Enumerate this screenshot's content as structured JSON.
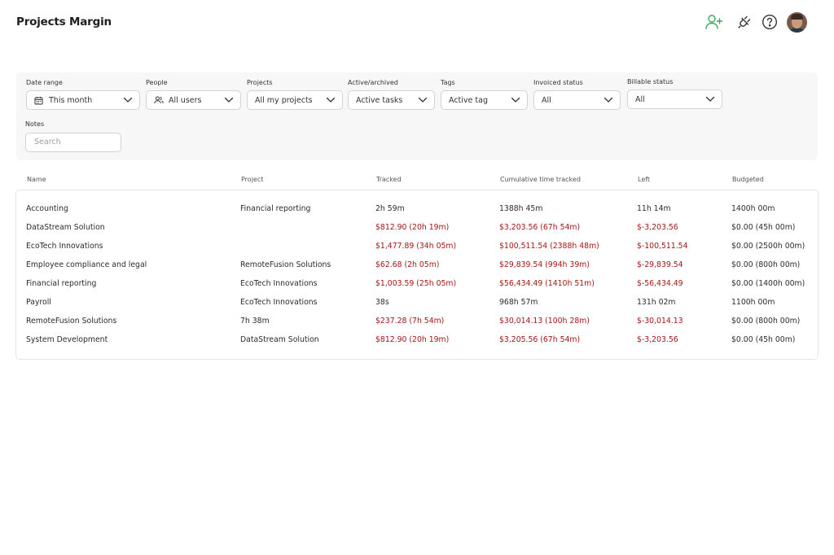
{
  "header": {
    "title": "Projects Margin",
    "icons": [
      "add-user-icon",
      "plug-icon",
      "help-icon",
      "avatar"
    ],
    "accent_color": "#3bab5a"
  },
  "filters": {
    "date_range": {
      "label": "Date range",
      "value": "This month"
    },
    "people": {
      "label": "People",
      "value": "All users"
    },
    "projects": {
      "label": "Projects",
      "value": "All my projects"
    },
    "active_archived": {
      "label": "Active/archived",
      "value": "Active tasks"
    },
    "tags": {
      "label": "Tags",
      "value": "Active tag"
    },
    "invoiced_status": {
      "label": "Invoiced status",
      "value": "All"
    },
    "billable_status": {
      "label": "Billable status",
      "value": "All"
    },
    "notes": {
      "label": "Notes",
      "placeholder": "Search"
    }
  },
  "table": {
    "overrun_color": "#a31515",
    "columns": {
      "name": "Name",
      "project": "Project",
      "tracked": "Tracked",
      "cumulative": "Cumulative time tracked",
      "left": "Left",
      "budgeted": "Budgeted"
    },
    "rows": [
      {
        "name": "Accounting",
        "project": "Financial reporting",
        "tracked": "2h 59m",
        "cumulative": "1388h 45m",
        "left": "11h 14m",
        "budgeted": "1400h 00m",
        "overrun": false
      },
      {
        "name": "DataStream Solution",
        "project": "",
        "tracked": "$812.90 (20h 19m)",
        "cumulative": "$3,203.56 (67h 54m)",
        "left": "$-3,203.56",
        "budgeted": "$0.00 (45h 00m)",
        "overrun": true
      },
      {
        "name": "EcoTech Innovations",
        "project": "",
        "tracked": "$1,477.89 (34h 05m)",
        "cumulative": "$100,511.54 (2388h 48m)",
        "left": "$-100,511.54",
        "budgeted": "$0.00 (2500h 00m)",
        "overrun": true
      },
      {
        "name": "Employee compliance and legal",
        "project": "RemoteFusion Solutions",
        "tracked": "$62.68 (2h 05m)",
        "cumulative": "$29,839.54 (994h 39m)",
        "left": "$-29,839.54",
        "budgeted": "$0.00 (800h 00m)",
        "overrun": true
      },
      {
        "name": "Financial reporting",
        "project": "EcoTech Innovations",
        "tracked": "$1,003.59 (25h 05m)",
        "cumulative": "$56,434.49 (1410h 51m)",
        "left": "$-56,434.49",
        "budgeted": "$0.00 (1400h 00m)",
        "overrun": true
      },
      {
        "name": "Payroll",
        "project": "EcoTech Innovations",
        "tracked": "38s",
        "cumulative": "968h 57m",
        "left": "131h 02m",
        "budgeted": "1100h 00m",
        "overrun": false
      },
      {
        "name": "RemoteFusion Solutions",
        "project": "7h 38m",
        "tracked": "$237.28 (7h 54m)",
        "cumulative": "$30,014.13 (100h 28m)",
        "left": "$-30,014.13",
        "budgeted": "$0.00 (800h 00m)",
        "overrun": true
      },
      {
        "name": "System Development",
        "project": "DataStream Solution",
        "tracked": "$812.90 (20h 19m)",
        "cumulative": "$3,205.56 (67h 54m)",
        "left": "$-3,203.56",
        "budgeted": "$0.00 (45h 00m)",
        "overrun": true
      }
    ]
  }
}
